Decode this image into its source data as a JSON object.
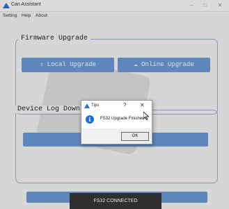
{
  "window": {
    "title": "Can Assistant",
    "min": "–",
    "max": "□",
    "close": "✕"
  },
  "menu": {
    "items": [
      "Setting",
      "Help",
      "About"
    ]
  },
  "firmware": {
    "title": "Firmware Upgrade",
    "local_label": "⇧ Local Upgrade",
    "online_label": "☁ Online Upgrade"
  },
  "device_log": {
    "title": "Device Log Downlo"
  },
  "dialog": {
    "title": "Tips",
    "help": "?",
    "close": "✕",
    "icon": "i",
    "message": "FS32 Upgrade Finished!",
    "ok_label": "OK"
  },
  "status": {
    "text": "FS32 CONNECTED"
  },
  "colors": {
    "accent": "#6e9ad8",
    "info_blue": "#1c6fd8",
    "panel_border": "#9fb0c8"
  }
}
